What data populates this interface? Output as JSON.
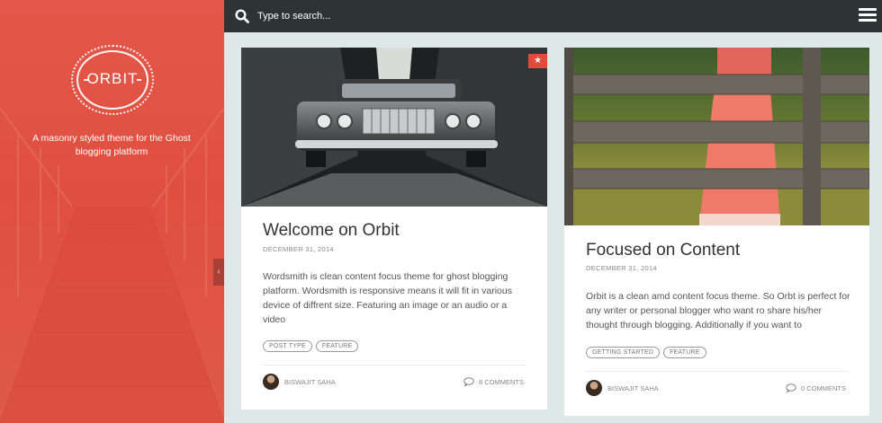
{
  "sidebar": {
    "logo_text": "ORBIT",
    "tagline": "A masonry styled theme for the Ghost blogging platform",
    "toggle_icon": "chevron-left"
  },
  "topbar": {
    "search_placeholder": "Type to search...",
    "search_icon": "search-icon",
    "menu_icon": "hamburger-menu-icon"
  },
  "posts": [
    {
      "title": "Welcome on Orbit",
      "date": "DECEMBER 31, 2014",
      "excerpt": "Wordsmith is clean content focus theme for ghost blogging platform. Wordsmith is responsive means it will fit in various device of diffrent size. Featuring an image or an audio or a video",
      "tags": [
        "POST TYPE",
        "FEATURE"
      ],
      "author": "BISWAJIT SAHA",
      "comments": "8 COMMENTS",
      "featured": true
    },
    {
      "title": "Focused on Content",
      "date": "DECEMBER 31, 2014",
      "excerpt": "Orbit is a clean amd content focus theme. So Orbt is perfect for any writer or personal blogger who want ro share his/her thought through blogging. Additionally if you want to",
      "tags": [
        "GETTING STARTED",
        "FEATURE"
      ],
      "author": "BISWAJIT SAHA",
      "comments": "0 COMMENTS",
      "featured": false
    }
  ],
  "colors": {
    "accent": "#e24b3b",
    "topbar": "#2e3336",
    "background": "#dfe8e8"
  }
}
